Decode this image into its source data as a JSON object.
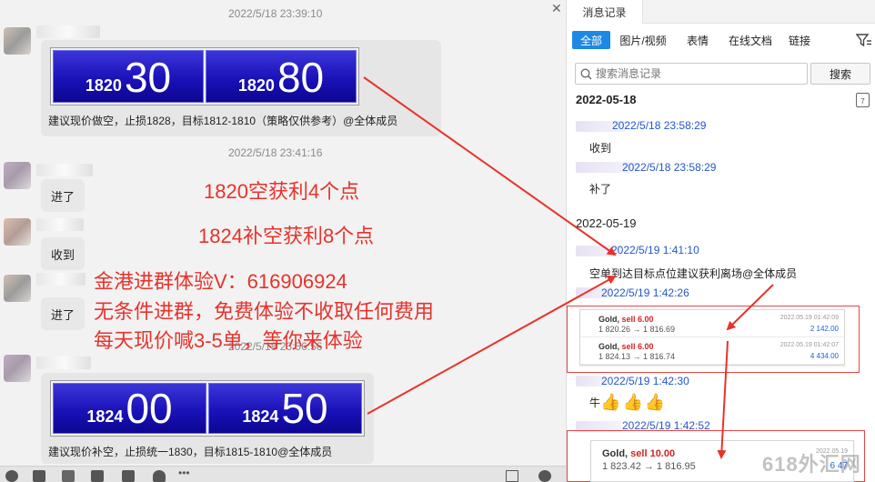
{
  "chat": {
    "timestamps": [
      "2022/5/18 23:39:10",
      "2022/5/18 23:41:16",
      "2022/5/18 23:56:56"
    ],
    "quote1": {
      "left_small": "1820",
      "left_large": "30",
      "right_small": "1820",
      "right_large": "80"
    },
    "msg1": "建议现价做空，止损1828，目标1812-1810（策略仅供参考）@全体成员",
    "short1": "进了",
    "short2": "收到",
    "short3": "进了",
    "quote2": {
      "left_small": "1824",
      "left_large": "00",
      "right_small": "1824",
      "right_large": "50"
    },
    "msg2": "建议现价补空，止损统一1830，目标1815-1810@全体成员"
  },
  "overlay": {
    "line1": "1820空获利4个点",
    "line2": "1824补空获利8个点",
    "line3": "金港进群体验V：616906924",
    "line4": "无条件进群，免费体验不收取任何费用",
    "line5": "每天现价喊3-5单，等你来体验",
    "accent_color": "#e8322c"
  },
  "history": {
    "tab_title": "消息记录",
    "filters": [
      "全部",
      "图片/视频",
      "表情",
      "在线文档",
      "链接"
    ],
    "search_placeholder": "搜索消息记录",
    "search_button": "搜索",
    "date1": "2022-05-18",
    "date2": "2022-05-19",
    "entries": [
      {
        "time": "2022/5/18 23:58:29",
        "text": "收到"
      },
      {
        "time": "2022/5/18 23:58:29",
        "text": "补了"
      },
      {
        "time": "2022/5/19 1:41:10",
        "text": "空单到达目标点位建议获利离场@全体成员"
      },
      {
        "time": "2022/5/19 1:42:26",
        "text": ""
      },
      {
        "time": "2022/5/19 1:42:30",
        "text": "牛"
      },
      {
        "time": "2022/5/19 1:42:52",
        "text": ""
      }
    ],
    "trades1": [
      {
        "sym": "Gold,",
        "side": "sell 6.00",
        "price": "1 820.26 → 1 816.69",
        "date": "2022.05.19 01:42:09",
        "pl": "2 142.00"
      },
      {
        "sym": "Gold,",
        "side": "sell 6.00",
        "price": "1 824.13 → 1 816.74",
        "date": "2022.05.19 01:42:07",
        "pl": "4 434.00"
      }
    ],
    "trade2": {
      "sym": "Gold,",
      "side": "sell 10.00",
      "price": "1 823.42 → 1 816.95",
      "date": "2022.05.19",
      "pl": "6 47"
    },
    "emoji": "👍"
  },
  "watermark": "618外汇网"
}
